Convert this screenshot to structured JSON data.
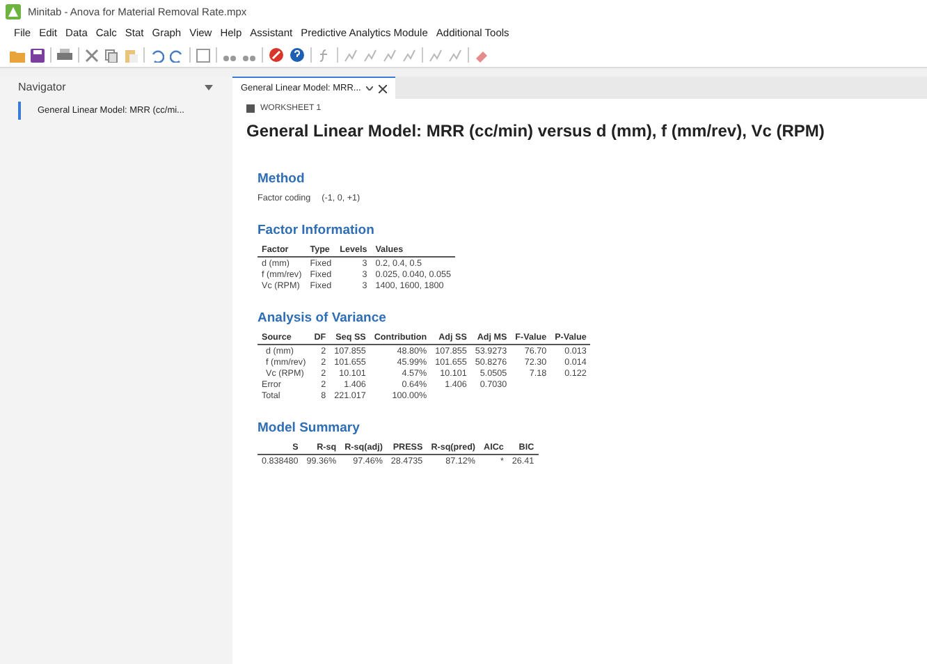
{
  "window": {
    "title": "Minitab - Anova for Material Removal Rate.mpx"
  },
  "menu": [
    "File",
    "Edit",
    "Data",
    "Calc",
    "Stat",
    "Graph",
    "View",
    "Help",
    "Assistant",
    "Predictive Analytics Module",
    "Additional Tools"
  ],
  "navigator": {
    "title": "Navigator",
    "items": [
      {
        "label": "General Linear Model: MRR (cc/mi...",
        "selected": true
      }
    ]
  },
  "tabs": [
    {
      "label": "General Linear Model: MRR...",
      "selected": true
    }
  ],
  "worksheet": "WORKSHEET 1",
  "title": "General Linear Model: MRR (cc/min) versus d (mm), f (mm/rev), Vc (RPM)",
  "sections": [
    {
      "kind": "pairs",
      "heading": "Method",
      "pairs": [
        {
          "label": "Factor coding",
          "value": "(-1, 0, +1)"
        }
      ]
    },
    {
      "kind": "table",
      "heading": "Factor Information",
      "columns": [
        {
          "label": "Factor",
          "kind": "text"
        },
        {
          "label": "Type",
          "kind": "text"
        },
        {
          "label": "Levels",
          "kind": "number"
        },
        {
          "label": "Values",
          "kind": "text"
        }
      ],
      "rows": [
        {
          "kind": "plain",
          "cells": [
            "d (mm)",
            "Fixed",
            "3",
            "0.2, 0.4, 0.5"
          ]
        },
        {
          "kind": "plain",
          "cells": [
            "f (mm/rev)",
            "Fixed",
            "3",
            "0.025, 0.040, 0.055"
          ]
        },
        {
          "kind": "plain",
          "cells": [
            "Vc (RPM)",
            "Fixed",
            "3",
            "1400, 1600, 1800"
          ]
        }
      ]
    },
    {
      "kind": "table",
      "heading": "Analysis of Variance",
      "columns": [
        {
          "label": "Source",
          "kind": "text"
        },
        {
          "label": "DF",
          "kind": "number"
        },
        {
          "label": "Seq SS",
          "kind": "number"
        },
        {
          "label": "Contribution",
          "kind": "number"
        },
        {
          "label": "Adj SS",
          "kind": "number"
        },
        {
          "label": "Adj MS",
          "kind": "number"
        },
        {
          "label": "F-Value",
          "kind": "number"
        },
        {
          "label": "P-Value",
          "kind": "number"
        }
      ],
      "rows": [
        {
          "kind": "term",
          "cells": [
            "d (mm)",
            "2",
            "107.855",
            "48.80%",
            "107.855",
            "53.9273",
            "76.70",
            "0.013"
          ]
        },
        {
          "kind": "term",
          "cells": [
            "f (mm/rev)",
            "2",
            "101.655",
            "45.99%",
            "101.655",
            "50.8276",
            "72.30",
            "0.014"
          ]
        },
        {
          "kind": "term",
          "cells": [
            "Vc (RPM)",
            "2",
            "10.101",
            "4.57%",
            "10.101",
            "5.0505",
            "7.18",
            "0.122"
          ]
        },
        {
          "kind": "plain",
          "cells": [
            "Error",
            "2",
            "1.406",
            "0.64%",
            "1.406",
            "0.7030"
          ]
        },
        {
          "kind": "plain",
          "cells": [
            "Total",
            "8",
            "221.017",
            "100.00%"
          ]
        }
      ]
    },
    {
      "kind": "table",
      "heading": "Model Summary",
      "columns": [
        {
          "label": "S",
          "kind": "number"
        },
        {
          "label": "R-sq",
          "kind": "number"
        },
        {
          "label": "R-sq(adj)",
          "kind": "number"
        },
        {
          "label": "PRESS",
          "kind": "number"
        },
        {
          "label": "R-sq(pred)",
          "kind": "number"
        },
        {
          "label": "AICc",
          "kind": "number"
        },
        {
          "label": "BIC",
          "kind": "number"
        }
      ],
      "rows": [
        {
          "kind": "plain",
          "cells": [
            "0.838480",
            "99.36%",
            "97.46%",
            "28.4735",
            "87.12%",
            "*",
            "26.41"
          ]
        }
      ]
    }
  ]
}
